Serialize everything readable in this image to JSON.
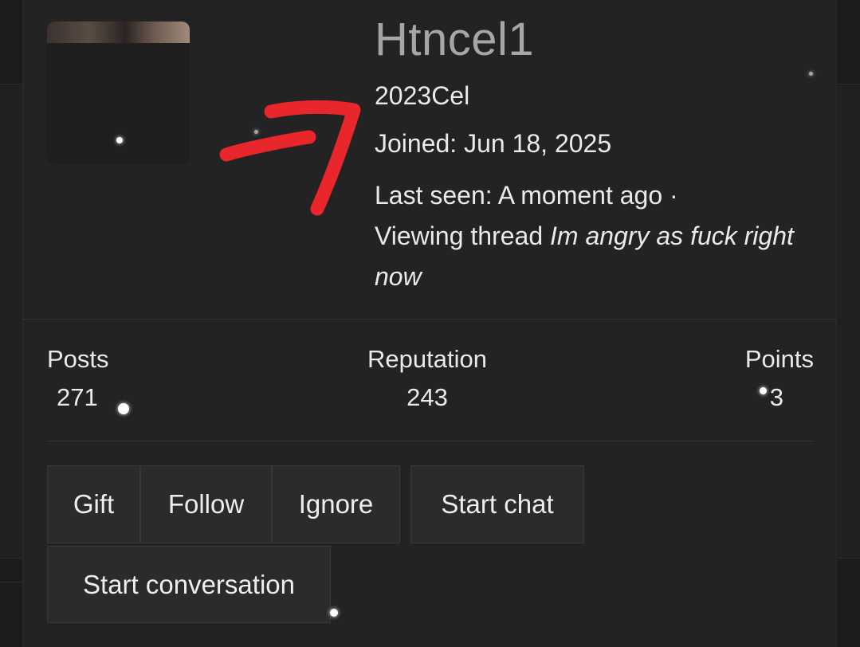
{
  "profile": {
    "username": "Htncel1",
    "user_title": "2023Cel",
    "joined_label": "Joined:",
    "joined_date": "Jun 18, 2025",
    "last_seen_label": "Last seen:",
    "last_seen_value": "A moment ago ·",
    "activity_prefix": "Viewing thread",
    "activity_thread": "Im angry as fuck right now"
  },
  "stats": {
    "posts_label": "Posts",
    "posts_value": "271",
    "reputation_label": "Reputation",
    "reputation_value": "243",
    "points_label": "Points",
    "points_value": "3"
  },
  "actions": {
    "gift": "Gift",
    "follow": "Follow",
    "ignore": "Ignore",
    "start_chat": "Start chat",
    "start_conversation": "Start conversation"
  },
  "annotation": {
    "arrow_color": "#e8262c"
  },
  "colors": {
    "background": "#1c1c1c",
    "card": "#232323",
    "button": "#2b2b2b",
    "username": "#a6a6a6",
    "text": "#eaeaea"
  }
}
